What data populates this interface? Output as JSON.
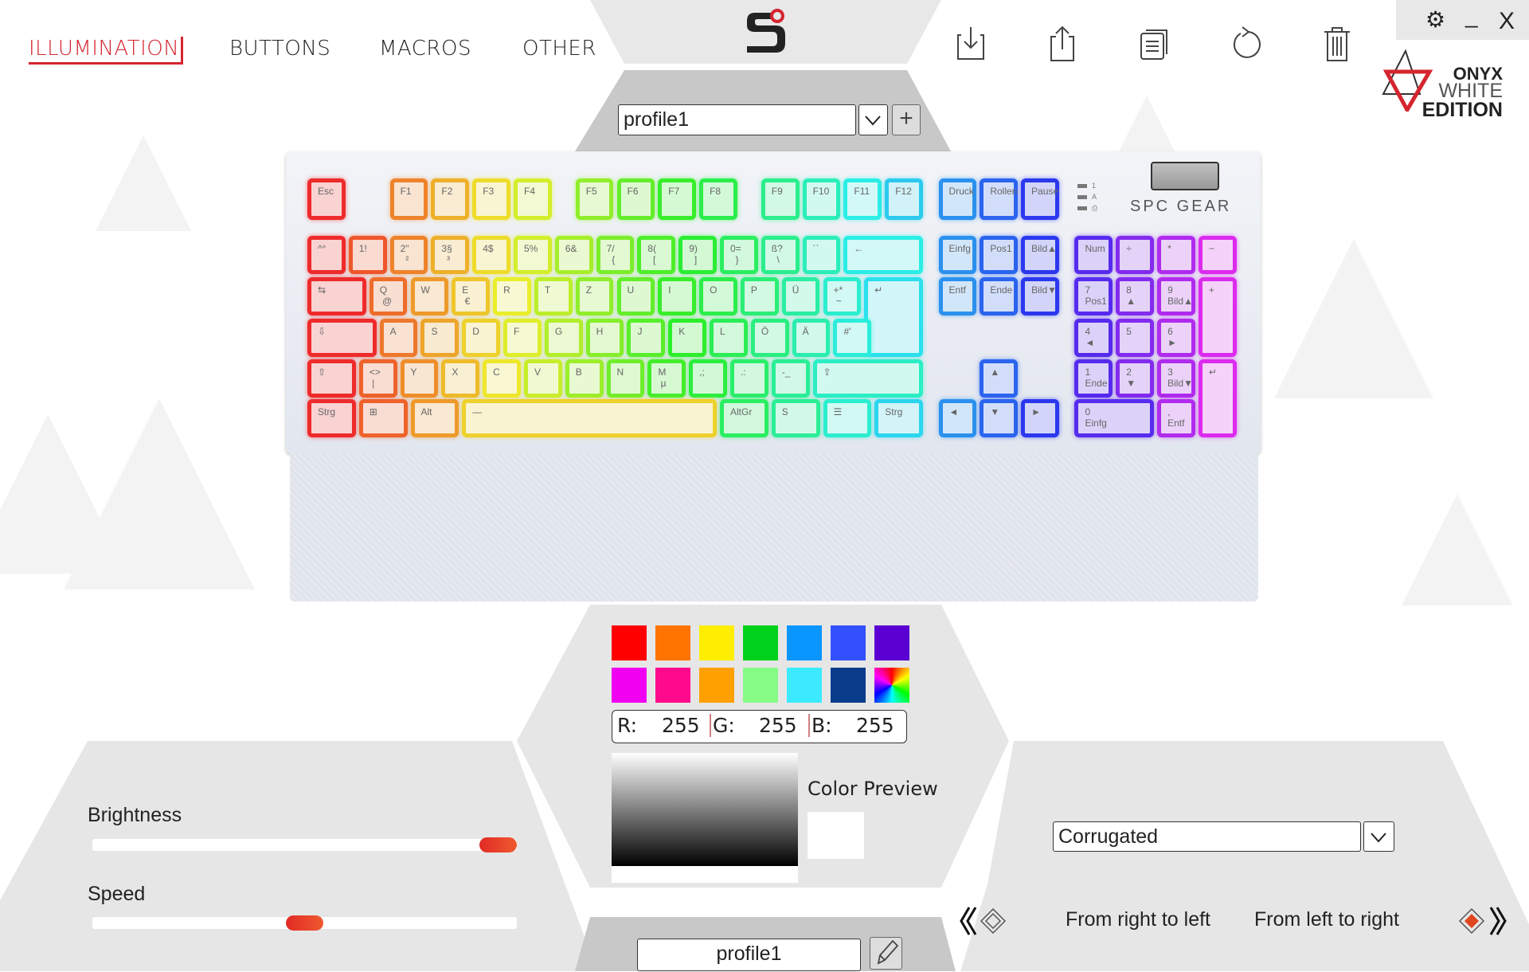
{
  "nav": {
    "tabs": [
      {
        "label": "ILLUMINATION",
        "active": true
      },
      {
        "label": "BUTTONS"
      },
      {
        "label": "MACROS"
      },
      {
        "label": "OTHER"
      }
    ]
  },
  "toolbar": {
    "icons": [
      "import-icon",
      "export-icon",
      "copy-icon",
      "reset-icon",
      "delete-icon"
    ]
  },
  "window": {
    "settings": "⚙",
    "minimize": "_",
    "close": "X"
  },
  "brand": {
    "logo_lines": [
      "ONYX",
      "WHITE",
      "EDITION"
    ]
  },
  "profile": {
    "selected": "profile1",
    "add": "+",
    "name_value": "profile1"
  },
  "keyboard": {
    "rows": [
      [
        "Esc",
        "F1",
        "F2",
        "F3",
        "F4",
        "F5",
        "F6",
        "F7",
        "F8",
        "F9",
        "F10",
        "F11",
        "F12",
        "Druck",
        "Rollen",
        "Pause"
      ],
      [
        "^°",
        "1!",
        "2\"\n  ²",
        "3§\n  ³",
        "4$",
        "5%",
        "6&",
        "7/\n  {",
        "8(\n  [",
        "9)\n  ]",
        "0=\n  }",
        "ß?\n  \\",
        "´`",
        "←",
        "Einfg",
        "Pos1",
        "Bild▲",
        "Num",
        "÷",
        "*",
        "−"
      ],
      [
        "⇆",
        "Q\n @",
        "W",
        "E\n €",
        "R",
        "T",
        "Z",
        "U",
        "I",
        "O",
        "P",
        "Ü",
        "+*\n ~",
        "↵",
        "Entf",
        "Ende",
        "Bild▼",
        "7\nPos1",
        "8\n▲",
        "9\nBild▲",
        "+"
      ],
      [
        "⇩",
        "A",
        "S",
        "D",
        "F",
        "G",
        "H",
        "J",
        "K",
        "L",
        "Ö",
        "Ä",
        "#'",
        "4\n◄",
        "5",
        "6\n►"
      ],
      [
        "⇧",
        "<>\n |",
        "Y",
        "X",
        "C",
        "V",
        "B",
        "N",
        "M\n µ",
        ",;",
        ".:",
        "-_",
        "⇧",
        "▲",
        "1\nEnde",
        "2\n▼",
        "3\nBild▼",
        "↵"
      ],
      [
        "Strg",
        "⊞",
        "Alt",
        "—",
        "AltGr",
        "S",
        "☰",
        "Strg",
        "◄",
        "▼",
        "►",
        "0\nEinfg",
        ",\nEntf"
      ]
    ],
    "brand": "SPC GEAR",
    "indicators": [
      "1",
      "A",
      "⎙"
    ]
  },
  "palette": {
    "colors": [
      "#ff0000",
      "#ff7300",
      "#ffee00",
      "#00d21c",
      "#0a96ff",
      "#3350ff",
      "#5a00d2",
      "#f000f0",
      "#ff0a8c",
      "#ffa000",
      "#86fb86",
      "#3ceaff",
      "#0a3c8c",
      "rainbow"
    ]
  },
  "rgb": {
    "r_label": "R:",
    "r": "255",
    "g_label": "G:",
    "g": "255",
    "b_label": "B:",
    "b": "255"
  },
  "color_preview": {
    "label": "Color Preview",
    "color": "#ffffff"
  },
  "sliders": {
    "brightness": {
      "label": "Brightness",
      "value": 100
    },
    "speed": {
      "label": "Speed",
      "value": 50
    }
  },
  "effect": {
    "selected": "Corrugated",
    "direction_left": "From right to left",
    "direction_right": "From left to right",
    "active_direction": "right"
  },
  "colors": {
    "accent": "#d4252f",
    "panel": "#e6e6e6",
    "panel_dark": "#c8c8c8"
  }
}
